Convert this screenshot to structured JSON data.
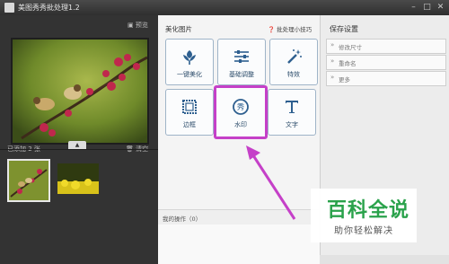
{
  "window": {
    "title": "美图秀秀批处理1.2",
    "controls": [
      "minimize",
      "maximize",
      "close"
    ]
  },
  "left_panel": {
    "preview_label": "预览",
    "added_count_text": "已添加 2 张",
    "clear_label": "清空",
    "thumbnails": [
      "bird-on-blossom-branch",
      "yellow-flower-field"
    ]
  },
  "center_panel": {
    "section_title": "美化图片",
    "tips_link": "批处理小技巧",
    "tools": [
      {
        "label": "一键美化",
        "icon": "flower-icon"
      },
      {
        "label": "基础调整",
        "icon": "sliders-icon"
      },
      {
        "label": "特效",
        "icon": "magic-wand-icon"
      },
      {
        "label": "边框",
        "icon": "frame-icon"
      },
      {
        "label": "水印",
        "icon": "watermark-seal-icon",
        "highlighted": true
      },
      {
        "label": "文字",
        "icon": "text-icon"
      }
    ],
    "ops_label": "我的操作（0）"
  },
  "right_panel": {
    "title": "保存设置",
    "rows": [
      "修改尺寸",
      "重命名",
      "更多"
    ]
  },
  "overlay_brand": {
    "main": "百科全说",
    "sub": "助你轻松解决",
    "color": "#2aa24b"
  },
  "colors": {
    "highlight": "#c540c8",
    "tool_text": "#2d4d6b",
    "tool_icon": "#2e5f8f"
  }
}
